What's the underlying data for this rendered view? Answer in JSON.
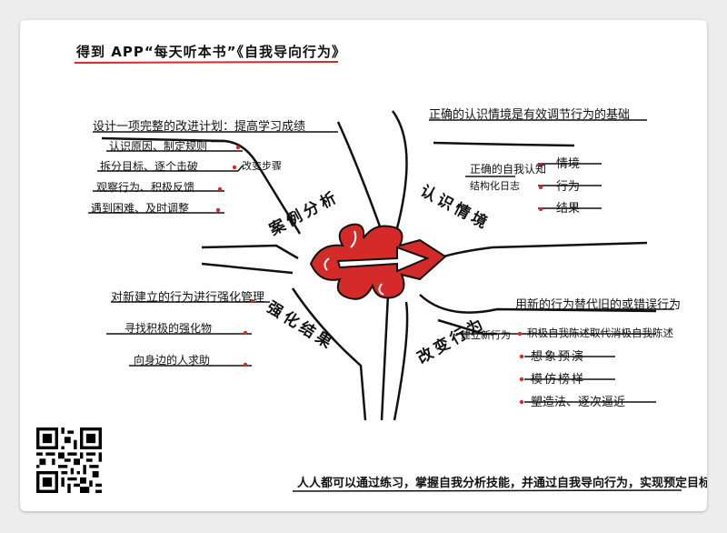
{
  "header": {
    "title": "得到 APP“每天听本书”《自我导向行为》"
  },
  "case_analysis": {
    "label": "案例分析",
    "heading": "设计一项完整的改进计划：提高学习成绩",
    "items": [
      "认识原因、制定规则",
      "拆分目标、逐个击破",
      "观察行为、积极反馈",
      "遇到困难、及时调整"
    ],
    "side_note": "改变步骤"
  },
  "recognize": {
    "label": "认识情境",
    "heading": "正确的认识情境是有效调节行为的基础",
    "sub_label_1": "正确的自我认知",
    "sub_label_2": "结构化日志",
    "items": [
      "情境",
      "行为",
      "结果"
    ]
  },
  "reinforce": {
    "label": "强化结果",
    "heading": "对新建立的行为进行强化管理",
    "items": [
      "寻找积极的强化物",
      "向身边的人求助"
    ]
  },
  "change": {
    "label": "改变行为",
    "heading": "用新的行为替代旧的或错误行为",
    "sub_label": "建立新行为",
    "items": [
      "积极自我陈述取代消极自我陈述",
      "想象预演",
      "模仿榜样",
      "塑造法、逐次逼近"
    ]
  },
  "footer": {
    "text": "人人都可以通过练习，掌握自我分析技能，并通过自我导向行为，实现预定目标。"
  },
  "colors": {
    "accent": "#d42a2a",
    "ink": "#111111"
  },
  "icons": {
    "center": "red-flame-arrow-icon",
    "qr": "qr-code-icon",
    "bullet": "red-dot-icon"
  }
}
